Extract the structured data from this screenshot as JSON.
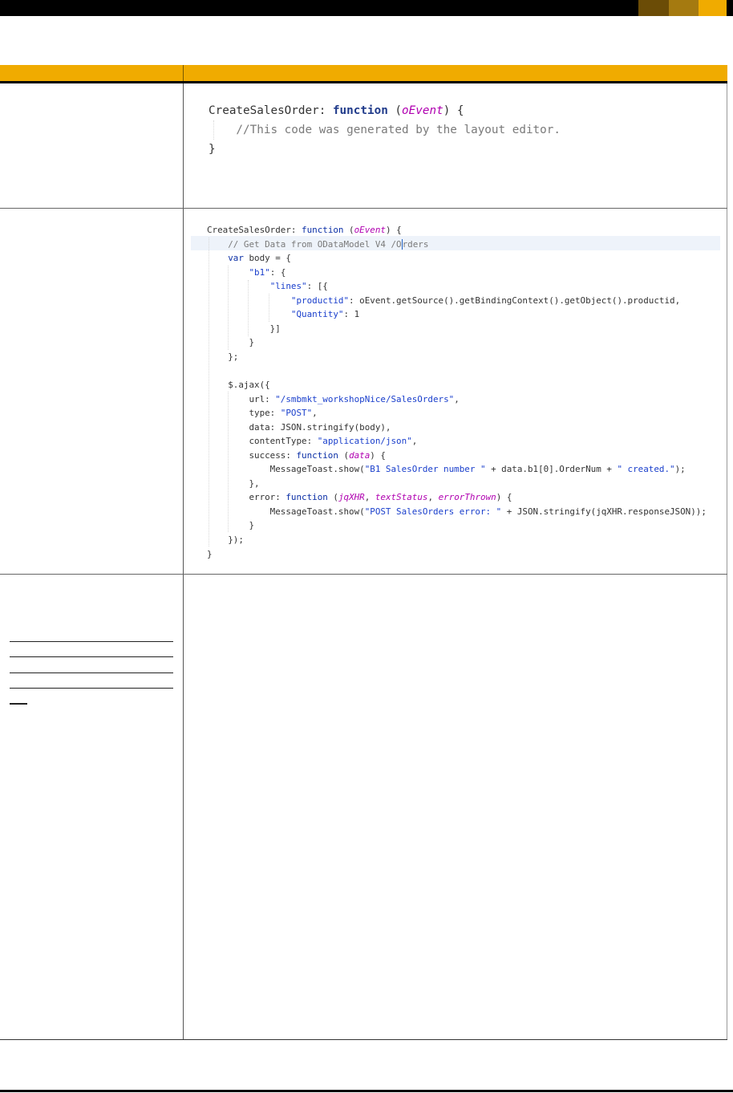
{
  "header_bar": {
    "colors": [
      "#000000",
      "#6b4c06",
      "#a57a10",
      "#f0ab00"
    ]
  },
  "table": {
    "header_color": "#f0ab00",
    "rows": [
      {
        "code_lines": [
          "CreateSalesOrder: function (oEvent) {",
          "    //This code was generated by the layout editor.",
          "}"
        ]
      },
      {
        "code_lines": [
          "CreateSalesOrder: function (oEvent) {",
          "    // Get Data from ODataModel V4 /Orders",
          "    var body = {",
          "        \"b1\": {",
          "            \"lines\": [{",
          "                \"productid\": oEvent.getSource().getBindingContext().getObject().productid,",
          "                \"Quantity\": 1",
          "            }]",
          "        }",
          "    };",
          "",
          "    $.ajax({",
          "        url: \"/smbmkt_workshopNice/SalesOrders\",",
          "        type: \"POST\",",
          "        data: JSON.stringify(body),",
          "        contentType: \"application/json\",",
          "        success: function (data) {",
          "            MessageToast.show(\"B1 SalesOrder number \" + data.b1[0].OrderNum + \" created.\");",
          "        },",
          "        error: function (jqXHR, textStatus, errorThrown) {",
          "            MessageToast.show(\"POST SalesOrders error: \" + JSON.stringify(jqXHR.responseJSON));",
          "        }",
          "    });",
          "}"
        ]
      },
      {
        "code_lines": []
      }
    ]
  }
}
